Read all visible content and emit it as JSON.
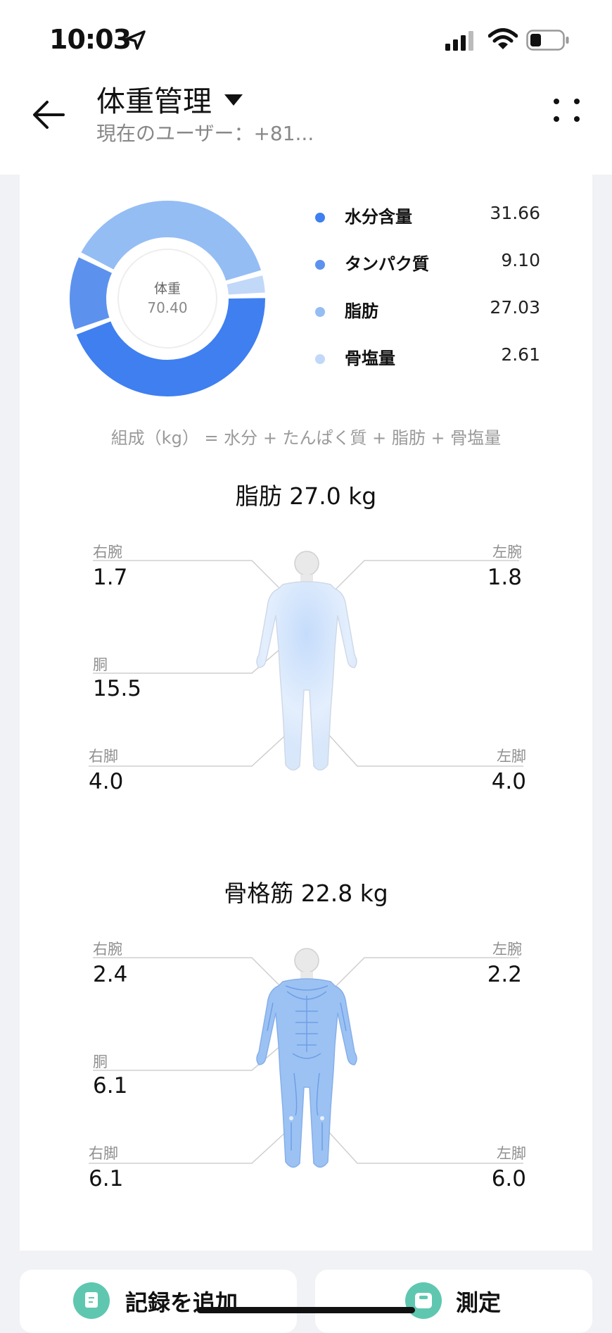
{
  "status": {
    "time": "10:03"
  },
  "header": {
    "title": "体重管理",
    "subtitle": "現在のユーザー：+81..."
  },
  "composition": {
    "center_label": "体重",
    "center_value": "70.40",
    "legend": [
      {
        "name": "水分含量",
        "value": "31.66",
        "color": "#3f7ff0"
      },
      {
        "name": "タンパク質",
        "value": "9.10",
        "color": "#5c92ee"
      },
      {
        "name": "脂肪",
        "value": "27.03",
        "color": "#94bdf4"
      },
      {
        "name": "骨塩量",
        "value": "2.61",
        "color": "#c2d8f8"
      }
    ],
    "formula": "組成（kg） = 水分 + たんぱく質 + 脂肪 + 骨塩量"
  },
  "fat": {
    "title": "脂肪 27.0 kg",
    "right_arm": {
      "label": "右腕",
      "value": "1.7"
    },
    "left_arm": {
      "label": "左腕",
      "value": "1.8"
    },
    "trunk": {
      "label": "胴",
      "value": "15.5"
    },
    "right_leg": {
      "label": "右脚",
      "value": "4.0"
    },
    "left_leg": {
      "label": "左脚",
      "value": "4.0"
    }
  },
  "muscle": {
    "title": "骨格筋 22.8 kg",
    "right_arm": {
      "label": "右腕",
      "value": "2.4"
    },
    "left_arm": {
      "label": "左腕",
      "value": "2.2"
    },
    "trunk": {
      "label": "胴",
      "value": "6.1"
    },
    "right_leg": {
      "label": "右脚",
      "value": "6.1"
    },
    "left_leg": {
      "label": "左脚",
      "value": "6.0"
    }
  },
  "actions": {
    "add_record": "記録を追加",
    "measure": "測定"
  }
}
